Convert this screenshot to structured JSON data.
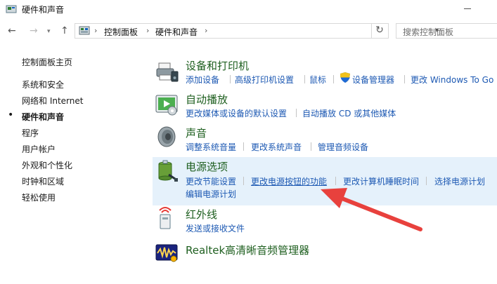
{
  "window": {
    "title": "硬件和声音"
  },
  "address": {
    "crumbs": [
      "控制面板",
      "硬件和声音"
    ],
    "search_placeholder": "搜索控制面板"
  },
  "sidebar": {
    "items": [
      {
        "label": "控制面板主页"
      },
      {
        "label": "系统和安全"
      },
      {
        "label": "网络和 Internet"
      },
      {
        "label": "硬件和声音",
        "current": true
      },
      {
        "label": "程序"
      },
      {
        "label": "用户帐户"
      },
      {
        "label": "外观和个性化"
      },
      {
        "label": "时钟和区域"
      },
      {
        "label": "轻松使用"
      }
    ]
  },
  "categories": {
    "devices": {
      "title": "设备和打印机",
      "links": [
        "添加设备",
        "高级打印机设置",
        "鼠标",
        "设备管理器",
        "更改 Windows To Go"
      ]
    },
    "autoplay": {
      "title": "自动播放",
      "links": [
        "更改媒体或设备的默认设置",
        "自动播放 CD 或其他媒体"
      ]
    },
    "sound": {
      "title": "声音",
      "links": [
        "调整系统音量",
        "更改系统声音",
        "管理音频设备"
      ]
    },
    "power": {
      "title": "电源选项",
      "links": [
        "更改节能设置",
        "更改电源按钮的功能",
        "更改计算机睡眠时间",
        "选择电源计划",
        "编辑电源计划"
      ]
    },
    "infrared": {
      "title": "红外线",
      "links": [
        "发送或接收文件"
      ]
    },
    "realtek": {
      "title": "Realtek高清晰音频管理器"
    }
  },
  "colors": {
    "category_title": "#1e5f1f",
    "link": "#1d59b3",
    "highlight": "#e5f1fb",
    "annotation_arrow": "#e8413d"
  }
}
